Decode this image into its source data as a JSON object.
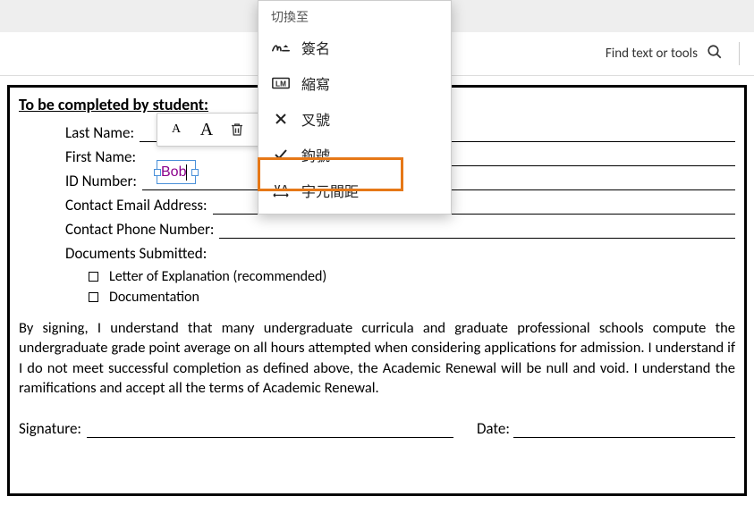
{
  "toolbar": {
    "find_label": "Find text or tools"
  },
  "form": {
    "header": "To be completed by student:",
    "last_name_label": "Last Name:",
    "first_name_label": "First Name:",
    "id_label": "ID Number:",
    "email_label": "Contact Email Address:",
    "phone_label": "Contact Phone Number:",
    "docs_label": "Documents Submitted:",
    "doc1": "Letter of Explanation (recommended)",
    "doc2": "Documentation",
    "body": "By signing, I understand that many undergraduate curricula and graduate professional schools compute the undergraduate grade point average on all hours attempted when considering applications for admission.  I understand if I do not meet successful completion as defined above, the Academic Renewal will be null and void. I understand the ramifications and accept all the terms of Academic Renewal.",
    "signature_label": "Signature:",
    "date_label": "Date:"
  },
  "text_input": {
    "value": "Bob"
  },
  "mini_toolbar": {
    "small_a": "A",
    "big_a": "A"
  },
  "context_menu": {
    "header": "切換至",
    "item1": "簽名",
    "item2": "縮寫",
    "item3": "叉號",
    "item4": "鉤號",
    "item5": "字元間距"
  }
}
